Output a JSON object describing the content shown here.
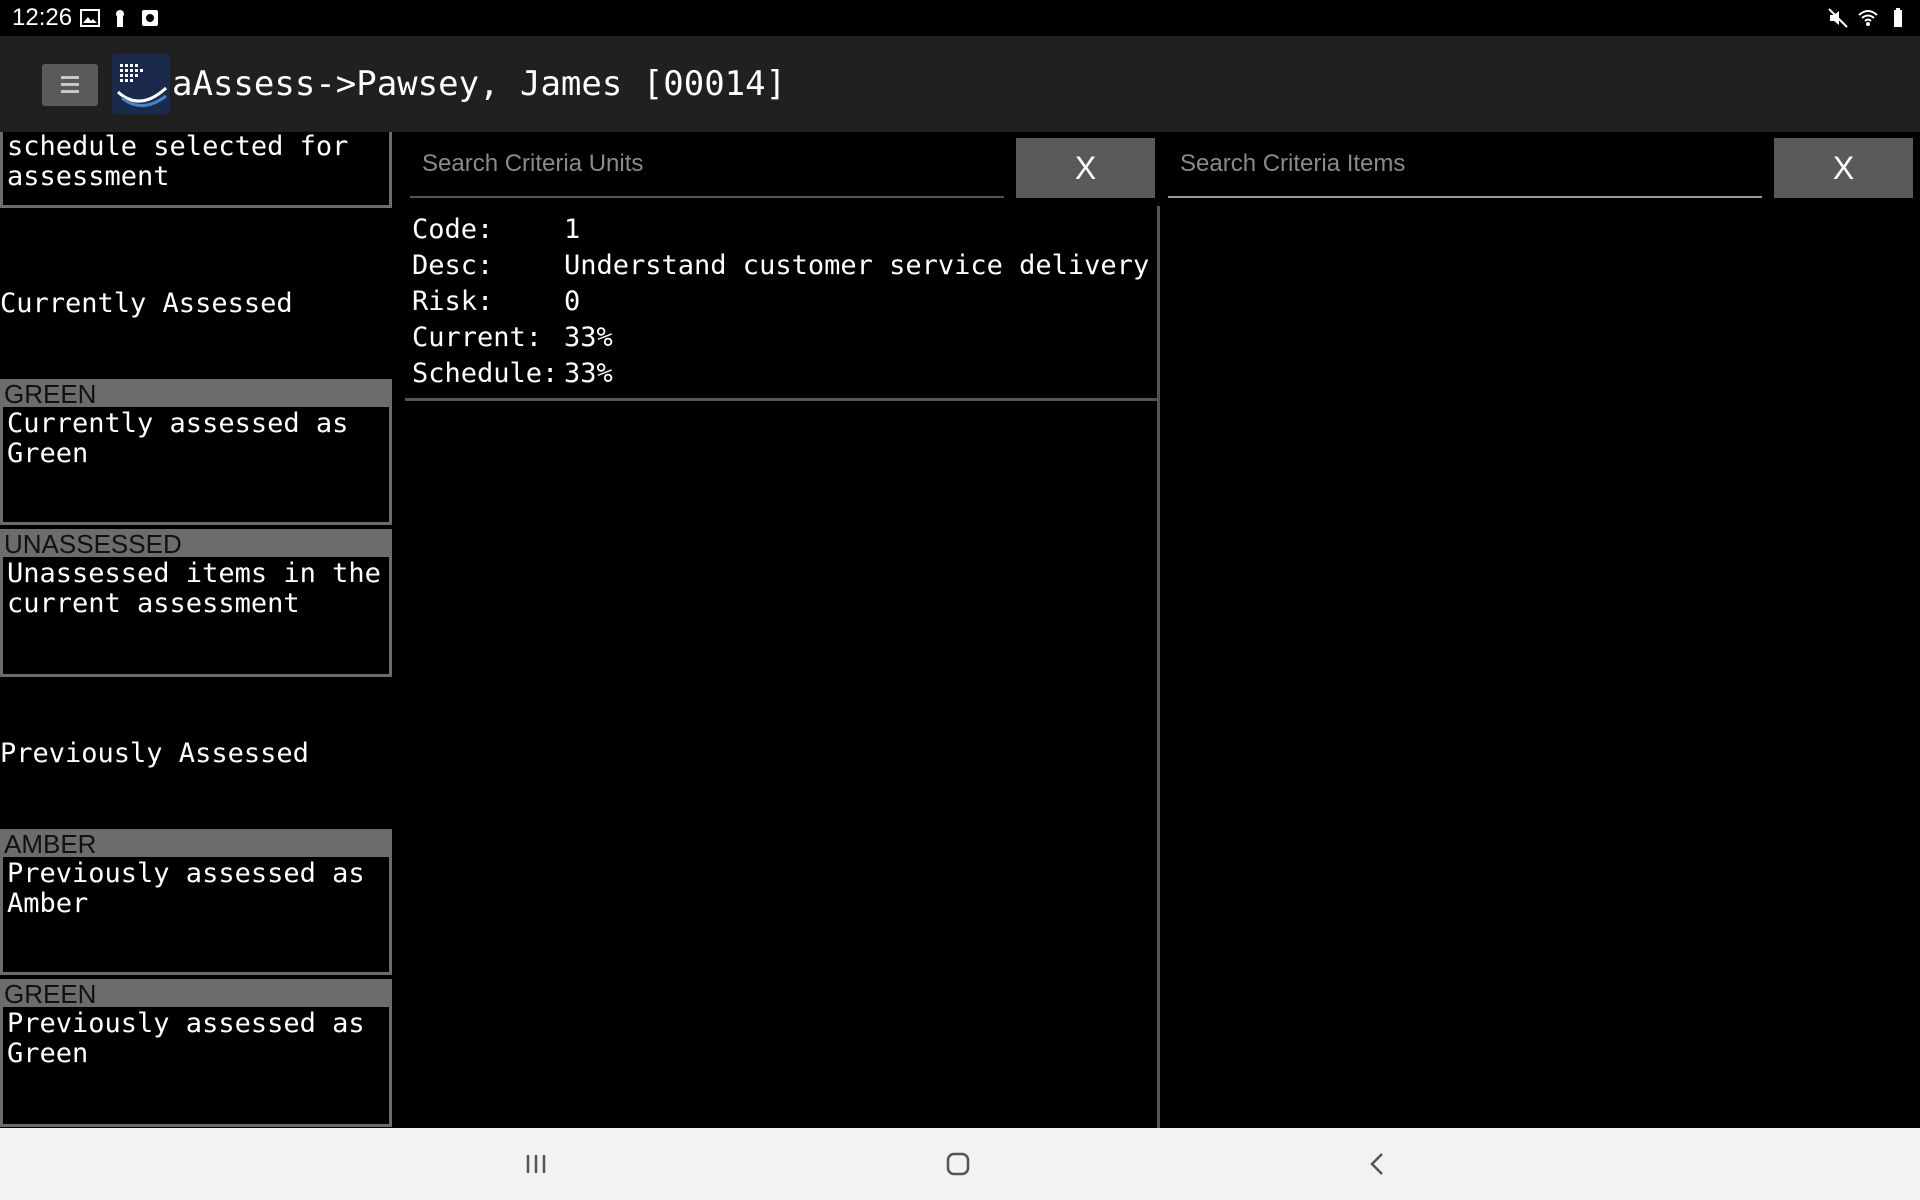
{
  "status_bar": {
    "time": "12:26",
    "left_icons": [
      "image-icon",
      "keyhole-icon",
      "screenshot-icon"
    ],
    "right_icons": [
      "mute-icon",
      "wifi-icon",
      "battery-icon"
    ]
  },
  "app_bar": {
    "title": "aAssess->Pawsey, James [00014]",
    "menu_icon": "hamburger-menu-icon",
    "logo_icon": "app-logo-icon"
  },
  "left_panel": {
    "top_card_text": "All units in the schedule selected for assessment",
    "currently_assessed_label": "Currently Assessed",
    "previously_assessed_label": "Previously Assessed",
    "current_cards": [
      {
        "tag": "GREEN",
        "text": "Currently assessed as Green"
      },
      {
        "tag": "UNASSESSED",
        "text": "Unassessed items in the current assessment"
      }
    ],
    "previous_cards": [
      {
        "tag": "AMBER",
        "text": "Previously assessed as Amber"
      },
      {
        "tag": "GREEN",
        "text": "Previously assessed as Green"
      }
    ]
  },
  "units_search": {
    "placeholder": "Search Criteria Units",
    "value": "",
    "clear_label": "X"
  },
  "items_search": {
    "placeholder": "Search Criteria Items",
    "value": "",
    "clear_label": "X"
  },
  "unit_details": {
    "code_label": "Code:",
    "code_value": "1",
    "desc_label": "Desc:",
    "desc_value": "Understand customer service delivery",
    "risk_label": "Risk:",
    "risk_value": "0",
    "current_label": "Current:",
    "current_value": "33%",
    "schedule_label": "Schedule:",
    "schedule_value": "33%"
  },
  "nav_bar": {
    "buttons": [
      "recents-icon",
      "home-icon",
      "back-icon"
    ]
  },
  "colors": {
    "background": "#000000",
    "app_bar": "#202020",
    "tag_gray": "#6c6c6c",
    "button_gray": "#5a5a5a",
    "nav_bar": "#f2f2f2"
  }
}
